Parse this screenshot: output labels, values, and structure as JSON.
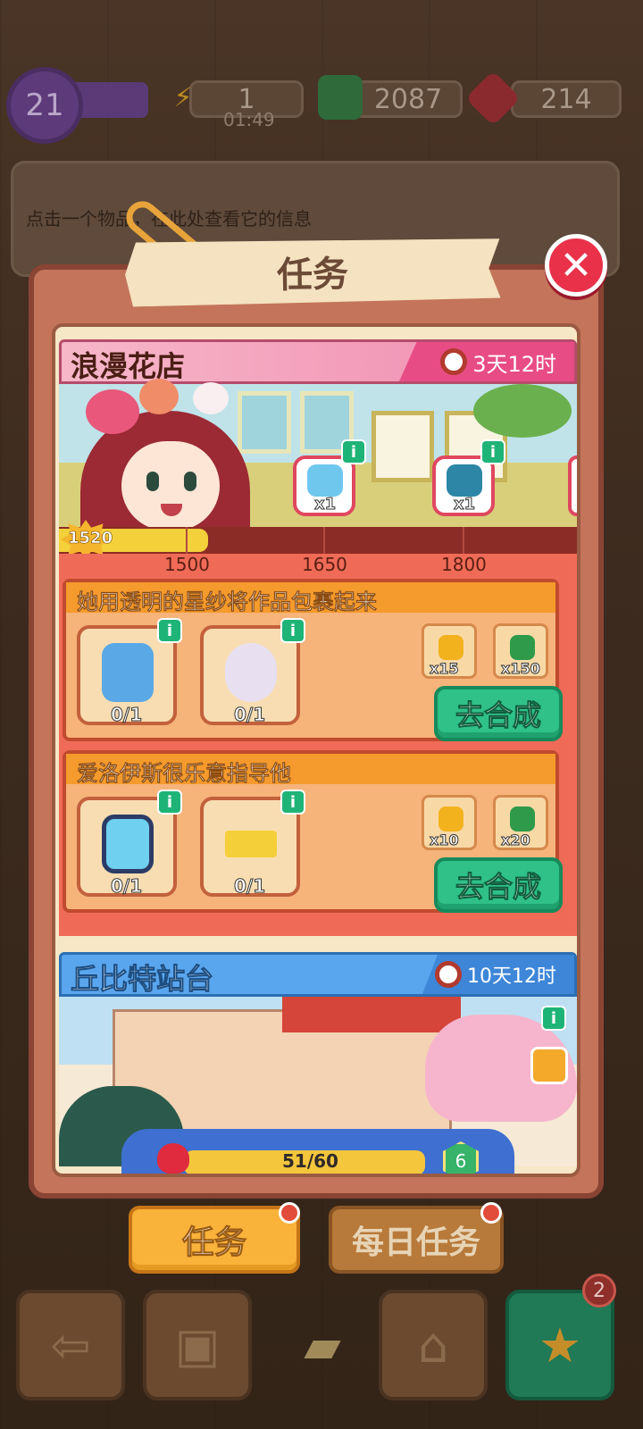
{
  "hud": {
    "level": "21",
    "energy": "1",
    "energy_timer": "01:49",
    "cash": "2087",
    "gems": "214",
    "icons": {
      "energy": "lightning-icon",
      "cash": "cash-stack-icon",
      "gems": "ruby-icon"
    }
  },
  "info_panel": {
    "hint": "点击一个物品，在此处查看它的信息"
  },
  "modal": {
    "title": "任务",
    "close_icon": "close-icon"
  },
  "quest1": {
    "name": "浪漫花店",
    "time_left": "3天12时",
    "progress_value": 1520,
    "progress_label": "1520",
    "milestones": [
      "1500",
      "1650",
      "1800"
    ],
    "milestone_rewards": [
      {
        "icon": "scissors-icon",
        "qty": "x1"
      },
      {
        "icon": "treasure-chest-icon",
        "qty": "x1"
      }
    ],
    "tasks": [
      {
        "title": "她用透明的星纱将作品包裹起来",
        "items": [
          {
            "icon": "spray-bottle-icon",
            "count": "0/1"
          },
          {
            "icon": "flower-bouquet-icon",
            "count": "0/1"
          }
        ],
        "rewards": [
          {
            "icon": "gold-rose-icon",
            "qty": "x15"
          },
          {
            "icon": "cash-icon",
            "qty": "x150"
          }
        ],
        "button": "去合成"
      },
      {
        "title": "爱洛伊斯很乐意指导他",
        "items": [
          {
            "icon": "sunglasses-icon",
            "count": "0/1"
          },
          {
            "icon": "caution-tape-icon",
            "count": "0/1"
          }
        ],
        "rewards": [
          {
            "icon": "gold-rose-icon",
            "qty": "x10"
          },
          {
            "icon": "cash-icon",
            "qty": "x20"
          }
        ],
        "button": "去合成"
      }
    ]
  },
  "quest2": {
    "name": "丘比特站台",
    "time_left": "10天12时",
    "hearts": "51/60",
    "level": "6"
  },
  "tabs": {
    "tasks": "任务",
    "daily": "每日任务"
  },
  "toolbar": {
    "star_count": "2"
  }
}
